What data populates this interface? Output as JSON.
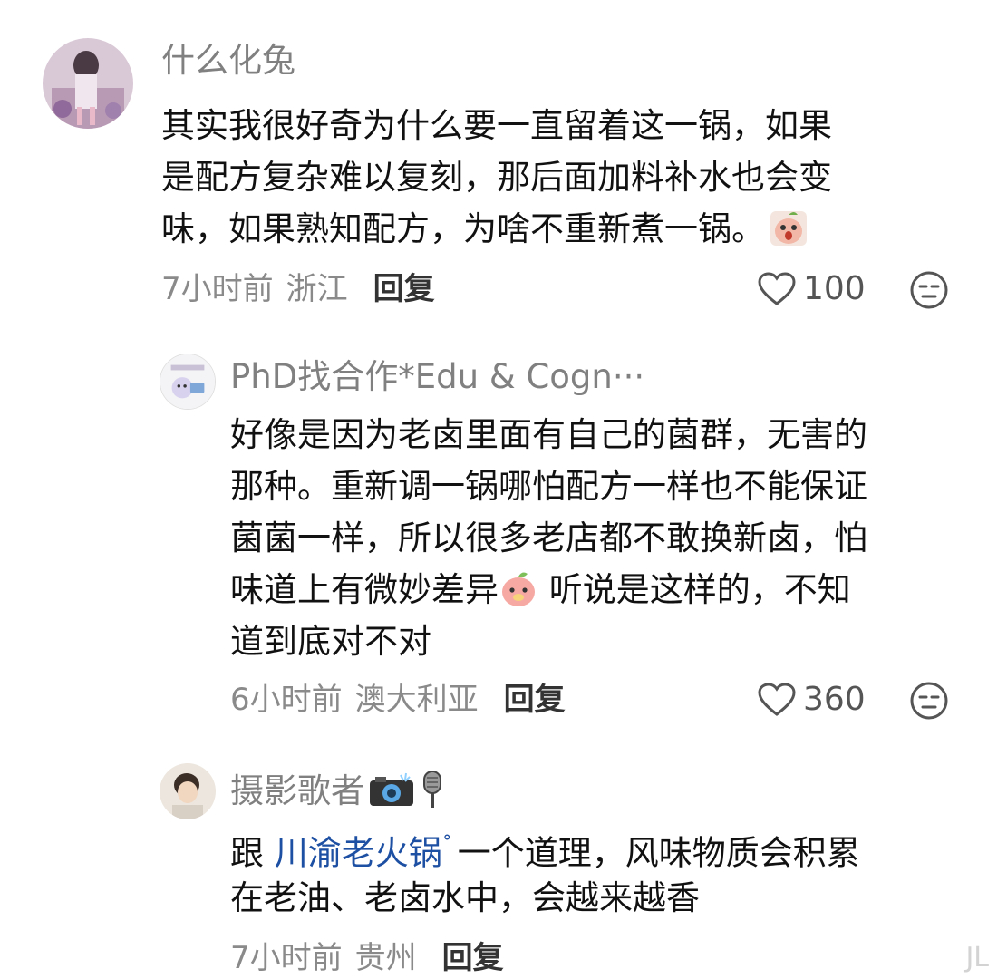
{
  "comments": [
    {
      "username": "什么化兔",
      "lines": [
        "其实我很好奇为什么要一直留着这一锅，如果",
        "是配方复杂难以复刻，那后面加料补水也会变",
        "味，如果熟知配方，为啥不重新煮一锅。"
      ],
      "time": "7小时前",
      "region": "浙江",
      "reply_label": "回复",
      "likes": "100"
    },
    {
      "username": "PhD找合作*Edu & Cogn···",
      "lines": [
        "好像是因为老卤里面有自己的菌群，无害的",
        "那种。重新调一锅哪怕配方一样也不能保证",
        "菌菌一样，所以很多老店都不敢换新卤，怕",
        "味道上有微妙差异",
        "道到底对不对"
      ],
      "line4_tail": " 听说是这样的，不知",
      "time": "6小时前",
      "region": "澳大利亚",
      "reply_label": "回复",
      "likes": "360"
    },
    {
      "username": "摄影歌者",
      "line1_prefix": "跟 ",
      "line1_link": "川渝老火锅",
      "line1_suffix": "一个道理，风味物质会积累",
      "line2": "在老油、老卤水中，会越来越香",
      "time": "7小时前",
      "region": "贵州",
      "reply_label": "回复"
    }
  ],
  "colors": {
    "username": "#808080",
    "body": "#111111",
    "meta": "#8a8a8a",
    "link": "#1d4fa3"
  },
  "icons": {
    "like": "heart-outline-icon",
    "dislike": "neutral-face-icon",
    "search": "search-mark-icon"
  },
  "watermark": "JL"
}
